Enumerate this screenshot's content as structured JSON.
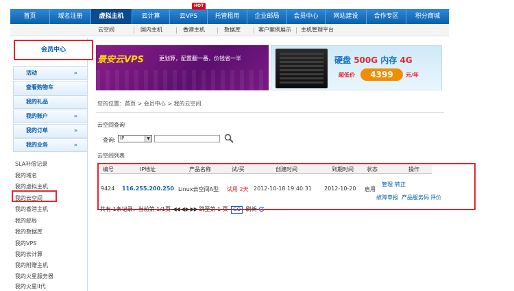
{
  "topnav": {
    "items": [
      "首页",
      "域名注册",
      "虚拟主机",
      "云计算",
      "云VPS",
      "托管租用",
      "企业邮局",
      "会员中心",
      "网站建设",
      "合作专区",
      "积分商城"
    ],
    "active_index": 2,
    "hot_badge": "HOT"
  },
  "subnav": {
    "items": [
      "云空间",
      "国内主机",
      "香港主机",
      "数据库",
      "客户案例展示",
      "主机管理平台"
    ]
  },
  "sidebar": {
    "member_center": "会员中心",
    "menu": [
      {
        "label": "活动",
        "chevron": "»"
      },
      {
        "label": "查看购物车",
        "chevron": ""
      },
      {
        "label": "我的礼品",
        "chevron": ""
      },
      {
        "label": "我的账户",
        "chevron": "»"
      },
      {
        "label": "我的订单",
        "chevron": "»"
      },
      {
        "label": "我的业务",
        "chevron": "»"
      }
    ],
    "sub_links": [
      "SLA补偿记录",
      "我的域名",
      "我的虚拟主机",
      "我的云空间",
      "我的香港主机",
      "我的邮局",
      "我的数据库",
      "我的VPS",
      "我的云计算",
      "我的附赠主机",
      "我的火星服务器",
      "我的火星II代"
    ]
  },
  "banner_vps": {
    "title": "景安云VPS",
    "tagline": "更划算，配置翻一番，价钱省一半"
  },
  "banner_disk": {
    "line1_prefix": "硬盘 ",
    "disk": "500G",
    "line1_mid": " 内存 ",
    "mem": "4G",
    "low_price": "超低价",
    "price": "4399",
    "per_year": "元/年"
  },
  "breadcrumb": "您的位置：首页 > 会员中心 > 我的云空间",
  "query": {
    "section_title": "云空间查询",
    "label": "查询:",
    "select_value": "IP",
    "input_value": ""
  },
  "list": {
    "section_title": "云空间列表",
    "headers": [
      "编号",
      "IP地址",
      "产品名称",
      "试/买",
      "创建时间",
      "到期时间",
      "状态",
      "操作"
    ],
    "row": {
      "id": "9424",
      "ip": "116.255.200.250",
      "product": "Linux云空间A型",
      "trial": "试用 2天",
      "created": "2012-10-18 19:40:31",
      "expires": "2012-10-20",
      "status": "启用",
      "actions_line1": [
        "管理",
        "转正"
      ],
      "actions_line2": [
        "故障申报",
        "产品服务码",
        "评价"
      ]
    }
  },
  "pager": {
    "summary": "共有 1条记录，当前第 1/1页",
    "arrows": "◀◀ ◀ ▶ ▶▶",
    "goto_label": "跳至第",
    "page_value": "1",
    "page_suffix": "页",
    "go": "GO",
    "refresh": "刷新"
  },
  "colors": {
    "nav_blue": "#0b5fae",
    "highlight_red": "#e3262b",
    "vps_purple": "#8d1d8c"
  }
}
